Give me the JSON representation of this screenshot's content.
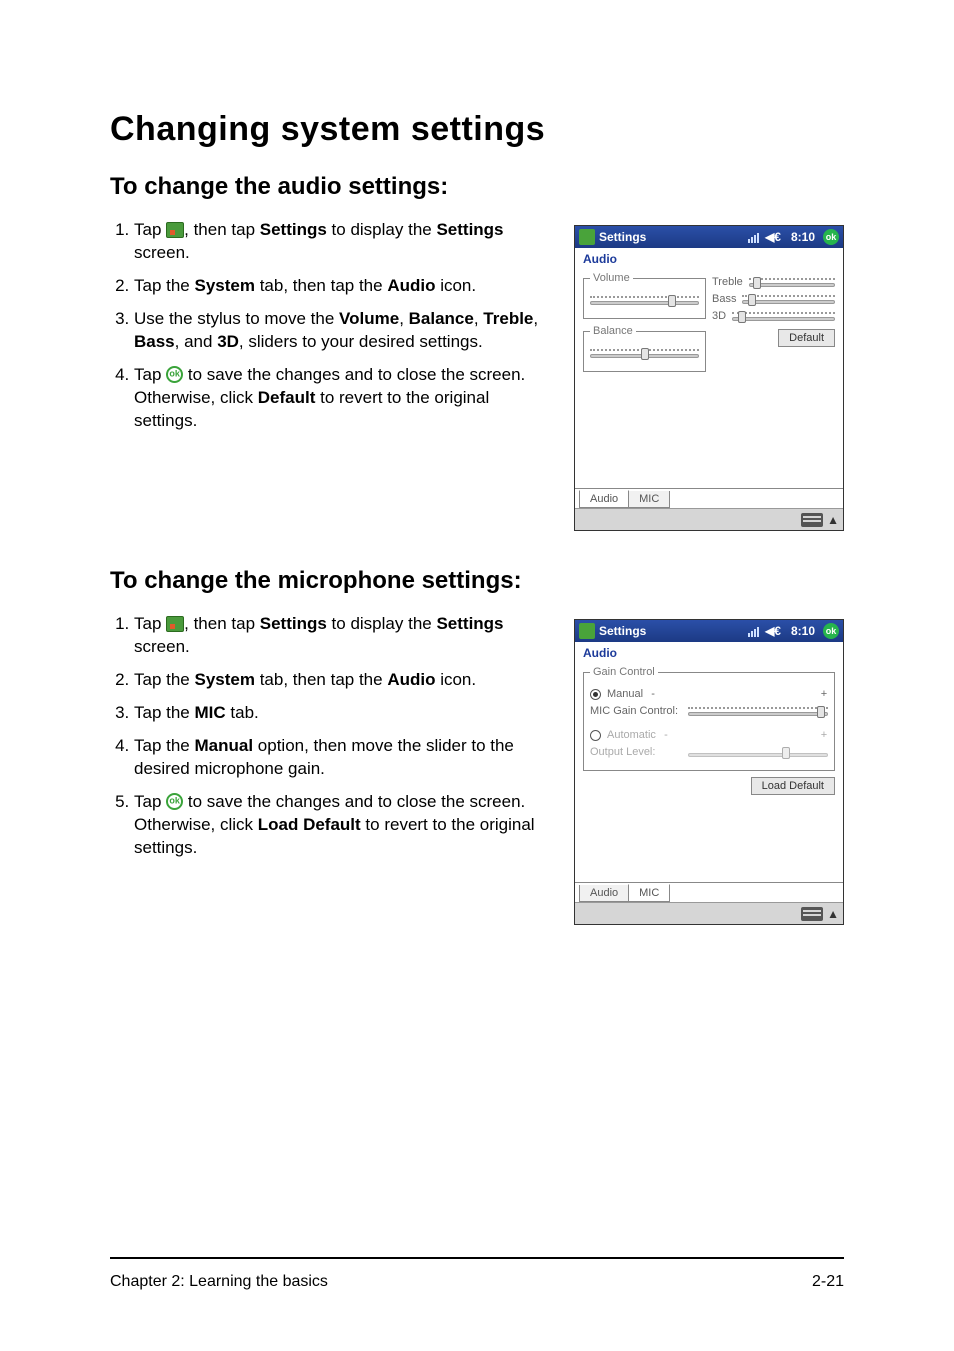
{
  "headings": {
    "h1": "Changing system settings",
    "h2_audio": "To change the audio settings:",
    "h2_mic": "To change the microphone settings:"
  },
  "audio_steps_text": {
    "s1a": "Tap ",
    "s1b": ", then tap ",
    "s1_settings": "Settings",
    "s1c": " to display the ",
    "s1_settings2": "Settings",
    "s1d": " screen.",
    "s2a": "Tap the ",
    "s2_system": "System",
    "s2b": " tab, then tap the ",
    "s2_audio": "Audio",
    "s2c": " icon.",
    "s3a": "Use the stylus to move the ",
    "s3_vol": "Volume",
    "s3_sep1": ", ",
    "s3_bal": "Balance",
    "s3_sep2": ", ",
    "s3_treb": "Treble",
    "s3_sep3": ", ",
    "s3_bass": "Bass",
    "s3_sep4": ", and ",
    "s3_3d": "3D",
    "s3b": ", sliders to your desired settings.",
    "s4a": "Tap ",
    "s4b": " to save the changes and to close the screen. Otherwise, click ",
    "s4_default": "Default",
    "s4c": " to revert to the original settings."
  },
  "mic_steps_text": {
    "s1a": "Tap ",
    "s1b": ", then tap ",
    "s1_settings": "Settings",
    "s1c": " to display the ",
    "s1_settings2": "Settings",
    "s1d": " screen.",
    "s2a": "Tap the ",
    "s2_system": "System",
    "s2b": " tab, then tap the ",
    "s2_audio": "Audio",
    "s2c": " icon.",
    "s3a": "Tap the ",
    "s3_mic": "MIC",
    "s3b": " tab.",
    "s4a": "Tap the ",
    "s4_manual": "Manual",
    "s4b": " option, then move the slider to the desired microphone gain.",
    "s5a": "Tap ",
    "s5b": " to save the changes and to close the screen. Otherwise, click ",
    "s5_load": "Load Default",
    "s5c": " to revert to the original settings."
  },
  "pda_common": {
    "app_title": "Settings",
    "time": "8:10",
    "ok": "ok",
    "screen_title": "Audio",
    "tab_audio": "Audio",
    "tab_mic": "MIC"
  },
  "pda_audio": {
    "volume_label": "Volume",
    "balance_label": "Balance",
    "treble_label": "Treble",
    "bass_label": "Bass",
    "threeD_label": "3D",
    "default_btn": "Default",
    "slider_positions": {
      "volume": 75,
      "balance": 50,
      "treble": 10,
      "bass": 10,
      "threeD": 10
    }
  },
  "pda_mic": {
    "group_label": "Gain Control",
    "manual_label": "Manual",
    "mic_gain_label": "MIC Gain Control:",
    "automatic_label": "Automatic",
    "output_level_label": "Output Level:",
    "load_default_btn": "Load Default",
    "slider_positions": {
      "mic_gain": 95,
      "output_level": 70
    },
    "selected": "Manual"
  },
  "footer": {
    "left": "Chapter 2: Learning the basics",
    "right": "2-21"
  }
}
